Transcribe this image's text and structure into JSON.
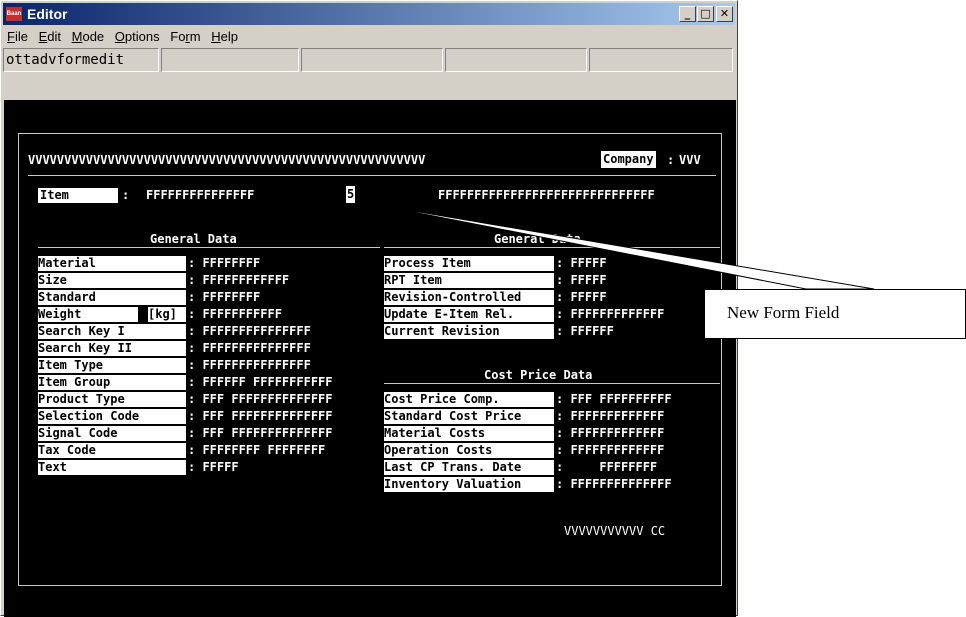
{
  "window": {
    "title": "Editor",
    "icon_label": "Baan"
  },
  "menu": [
    {
      "u": "F",
      "rest": "ile"
    },
    {
      "u": "E",
      "rest": "dit"
    },
    {
      "u": "M",
      "rest": "ode"
    },
    {
      "u": "O",
      "rest": "ptions"
    },
    {
      "pre": "Fo",
      "u": "r",
      "rest": "m"
    },
    {
      "u": "H",
      "rest": "elp"
    }
  ],
  "toolbar": {
    "session": "ottadvformedit"
  },
  "form": {
    "header_title": "VVVVVVVVVVVVVVVVVVVVVVVVVVVVVVVVVVVVVVVVVVVVVVVVVVVVVVV",
    "company_label": "Company",
    "company_colon": ":",
    "company_value": "VVV",
    "item_label": "Item",
    "item_colon": ": ",
    "item_value": "FFFFFFFFFFFFFFF",
    "new_field_marker": "5",
    "item_desc": "FFFFFFFFFFFFFFFFFFFFFFFFFFFFFF",
    "general_left_title": "General Data",
    "general_right_title": "General Data",
    "cost_title": "Cost Price Data",
    "footer": "VVVVVVVVVVV CC",
    "left_rows": [
      {
        "label": "Material",
        "value": ": FFFFFFFF"
      },
      {
        "label": "Size",
        "value": ": FFFFFFFFFFFF"
      },
      {
        "label": "Standard",
        "value": ": FFFFFFFF"
      },
      {
        "label": "Weight",
        "unit": "[kg]",
        "value": ": FFFFFFFFFFF"
      },
      {
        "label": "Search Key I",
        "value": ": FFFFFFFFFFFFFFF"
      },
      {
        "label": "Search Key II",
        "value": ": FFFFFFFFFFFFFFF"
      },
      {
        "label": "Item Type",
        "value": ": FFFFFFFFFFFFFFF"
      },
      {
        "label": "Item Group",
        "value": ": FFFFFF FFFFFFFFFFF"
      },
      {
        "label": "Product Type",
        "value": ": FFF FFFFFFFFFFFFFF"
      },
      {
        "label": "Selection Code",
        "value": ": FFF FFFFFFFFFFFFFF"
      },
      {
        "label": "Signal Code",
        "value": ": FFF FFFFFFFFFFFFFF"
      },
      {
        "label": "Tax Code",
        "value": ": FFFFFFFF FFFFFFFF"
      },
      {
        "label": "Text",
        "value": ": FFFFF"
      }
    ],
    "right_rows": [
      {
        "label": "Process Item",
        "value": ": FFFFF"
      },
      {
        "label": "RPT Item",
        "value": ": FFFFF"
      },
      {
        "label": "Revision-Controlled",
        "value": ": FFFFF"
      },
      {
        "label": "Update E-Item Rel.",
        "value": ": FFFFFFFFFFFFF"
      },
      {
        "label": "Current Revision",
        "value": ": FFFFFF"
      }
    ],
    "cost_rows": [
      {
        "label": "Cost Price Comp.",
        "value": ": FFF FFFFFFFFFF"
      },
      {
        "label": "Standard Cost Price",
        "value": ": FFFFFFFFFFFFF"
      },
      {
        "label": "Material Costs",
        "value": ": FFFFFFFFFFFFF"
      },
      {
        "label": "Operation Costs",
        "value": ": FFFFFFFFFFFFF"
      },
      {
        "label": "Last CP Trans. Date",
        "value": ":     FFFFFFFF"
      },
      {
        "label": "Inventory Valuation",
        "value": ": FFFFFFFFFFFFFF"
      }
    ]
  },
  "callout": {
    "text": "New Form Field"
  }
}
